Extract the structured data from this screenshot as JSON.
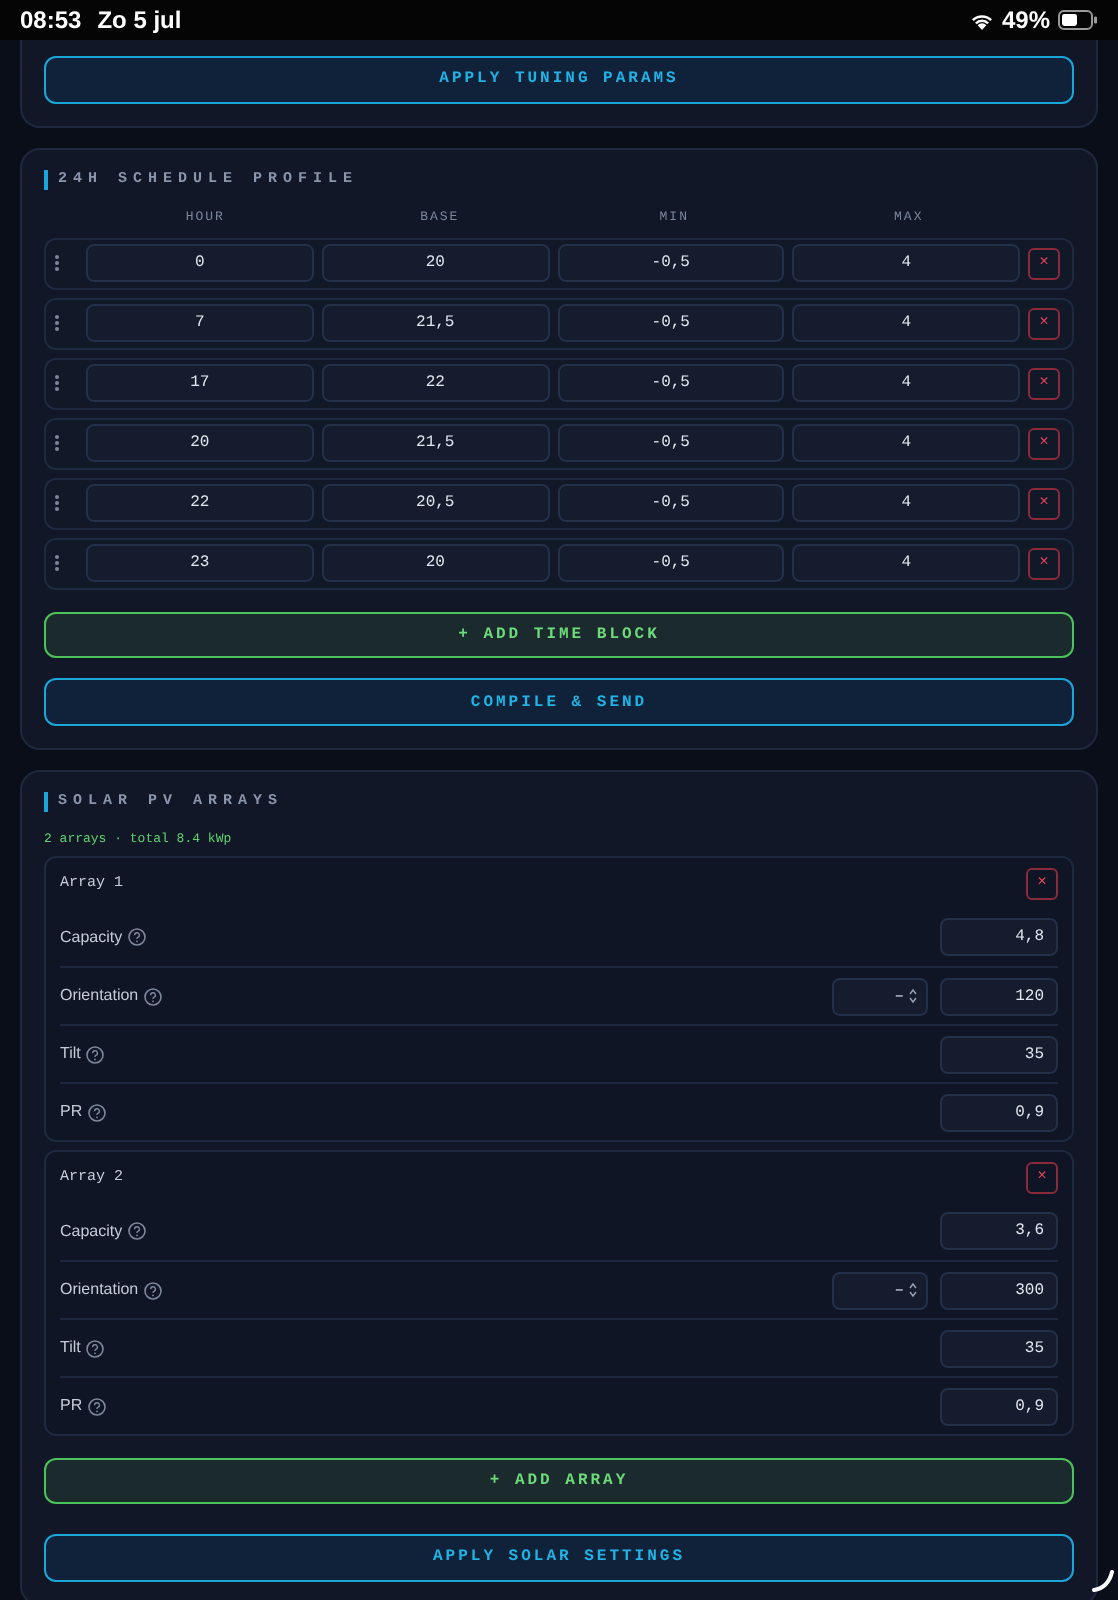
{
  "status_bar": {
    "time": "08:53",
    "date": "Zo 5 jul",
    "battery": "49%"
  },
  "tuning": {
    "apply_button": "APPLY TUNING PARAMS"
  },
  "schedule": {
    "title": "24H SCHEDULE PROFILE",
    "columns": [
      "HOUR",
      "BASE",
      "MIN",
      "MAX"
    ],
    "rows": [
      {
        "hour": "0",
        "base": "20",
        "min": "-0,5",
        "max": "4",
        "remove": "×"
      },
      {
        "hour": "7",
        "base": "21,5",
        "min": "-0,5",
        "max": "4",
        "remove": "×"
      },
      {
        "hour": "17",
        "base": "22",
        "min": "-0,5",
        "max": "4",
        "remove": "×"
      },
      {
        "hour": "20",
        "base": "21,5",
        "min": "-0,5",
        "max": "4",
        "remove": "×"
      },
      {
        "hour": "22",
        "base": "20,5",
        "min": "-0,5",
        "max": "4",
        "remove": "×"
      },
      {
        "hour": "23",
        "base": "20",
        "min": "-0,5",
        "max": "4",
        "remove": "×"
      }
    ],
    "add_button": "+ ADD TIME BLOCK",
    "send_button": "COMPILE & SEND"
  },
  "solar": {
    "title": "SOLAR PV ARRAYS",
    "summary": "2 arrays · total 8.4 kWp",
    "arrays": [
      {
        "name": "Array 1",
        "remove": "×",
        "fields": [
          {
            "kind": "number",
            "label": "Capacity",
            "value": "4,8"
          },
          {
            "kind": "select-number",
            "label": "Orientation",
            "select": "–",
            "value": "120"
          },
          {
            "kind": "number",
            "label": "Tilt",
            "value": "35"
          },
          {
            "kind": "number",
            "label": "PR",
            "value": "0,9"
          }
        ]
      },
      {
        "name": "Array 2",
        "remove": "×",
        "fields": [
          {
            "kind": "number",
            "label": "Capacity",
            "value": "3,6"
          },
          {
            "kind": "select-number",
            "label": "Orientation",
            "select": "–",
            "value": "300"
          },
          {
            "kind": "number",
            "label": "Tilt",
            "value": "35"
          },
          {
            "kind": "number",
            "label": "PR",
            "value": "0,9"
          }
        ]
      }
    ],
    "add_button": "+ ADD ARRAY",
    "apply_button": "APPLY SOLAR SETTINGS"
  }
}
